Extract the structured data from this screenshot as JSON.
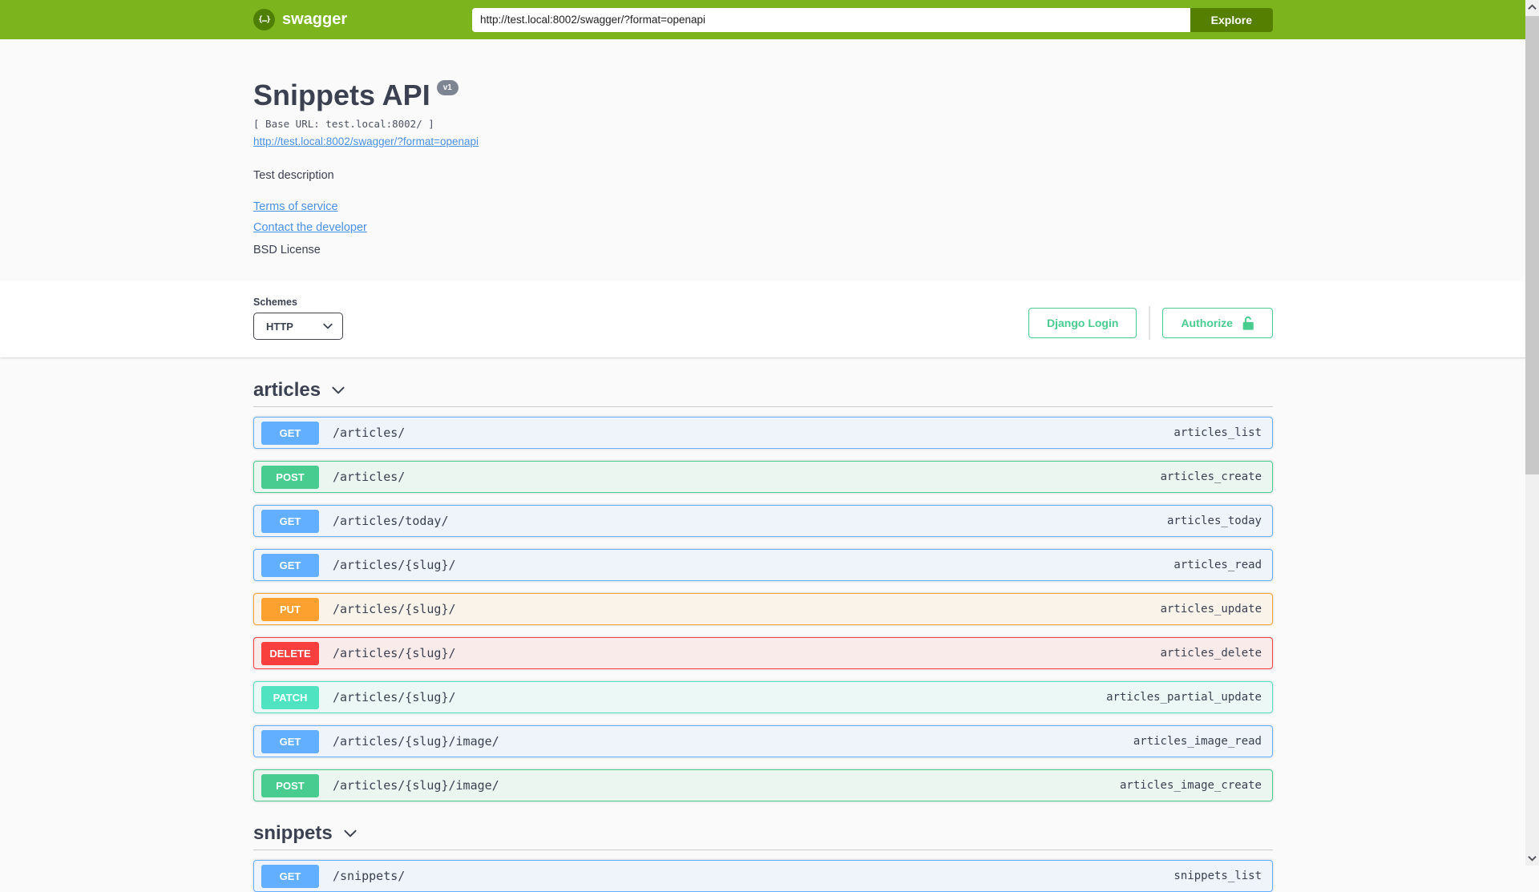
{
  "topbar": {
    "brand": "swagger",
    "logo_glyph": "{…}",
    "url_value": "http://test.local:8002/swagger/?format=openapi",
    "explore_label": "Explore"
  },
  "info": {
    "title": "Snippets API",
    "version_badge": "v1",
    "base_url_text": "[ Base URL: test.local:8002/ ]",
    "spec_link": "http://test.local:8002/swagger/?format=openapi",
    "description": "Test description",
    "terms_link": "Terms of service",
    "contact_link": "Contact the developer",
    "license_text": "BSD License"
  },
  "schemes": {
    "label": "Schemes",
    "selected": "HTTP"
  },
  "auth": {
    "django_login": "Django Login",
    "authorize": "Authorize"
  },
  "sections": [
    {
      "name": "articles",
      "operations": [
        {
          "method": "GET",
          "path": "/articles/",
          "operation_id": "articles_list"
        },
        {
          "method": "POST",
          "path": "/articles/",
          "operation_id": "articles_create"
        },
        {
          "method": "GET",
          "path": "/articles/today/",
          "operation_id": "articles_today"
        },
        {
          "method": "GET",
          "path": "/articles/{slug}/",
          "operation_id": "articles_read"
        },
        {
          "method": "PUT",
          "path": "/articles/{slug}/",
          "operation_id": "articles_update"
        },
        {
          "method": "DELETE",
          "path": "/articles/{slug}/",
          "operation_id": "articles_delete"
        },
        {
          "method": "PATCH",
          "path": "/articles/{slug}/",
          "operation_id": "articles_partial_update"
        },
        {
          "method": "GET",
          "path": "/articles/{slug}/image/",
          "operation_id": "articles_image_read"
        },
        {
          "method": "POST",
          "path": "/articles/{slug}/image/",
          "operation_id": "articles_image_create"
        }
      ]
    },
    {
      "name": "snippets",
      "operations": [
        {
          "method": "GET",
          "path": "/snippets/",
          "operation_id": "snippets_list"
        }
      ]
    }
  ],
  "colors": {
    "topbar_bg": "#7cb41e",
    "explore_bg": "#547f00",
    "method_get": "#61affe",
    "method_post": "#49cc90",
    "method_put": "#fca130",
    "method_delete": "#f93e3e",
    "method_patch": "#50e3c2",
    "accent_green": "#49cc90",
    "link_blue": "#4990e2",
    "text_dark": "#3b4151",
    "version_badge_bg": "#7d8492"
  }
}
